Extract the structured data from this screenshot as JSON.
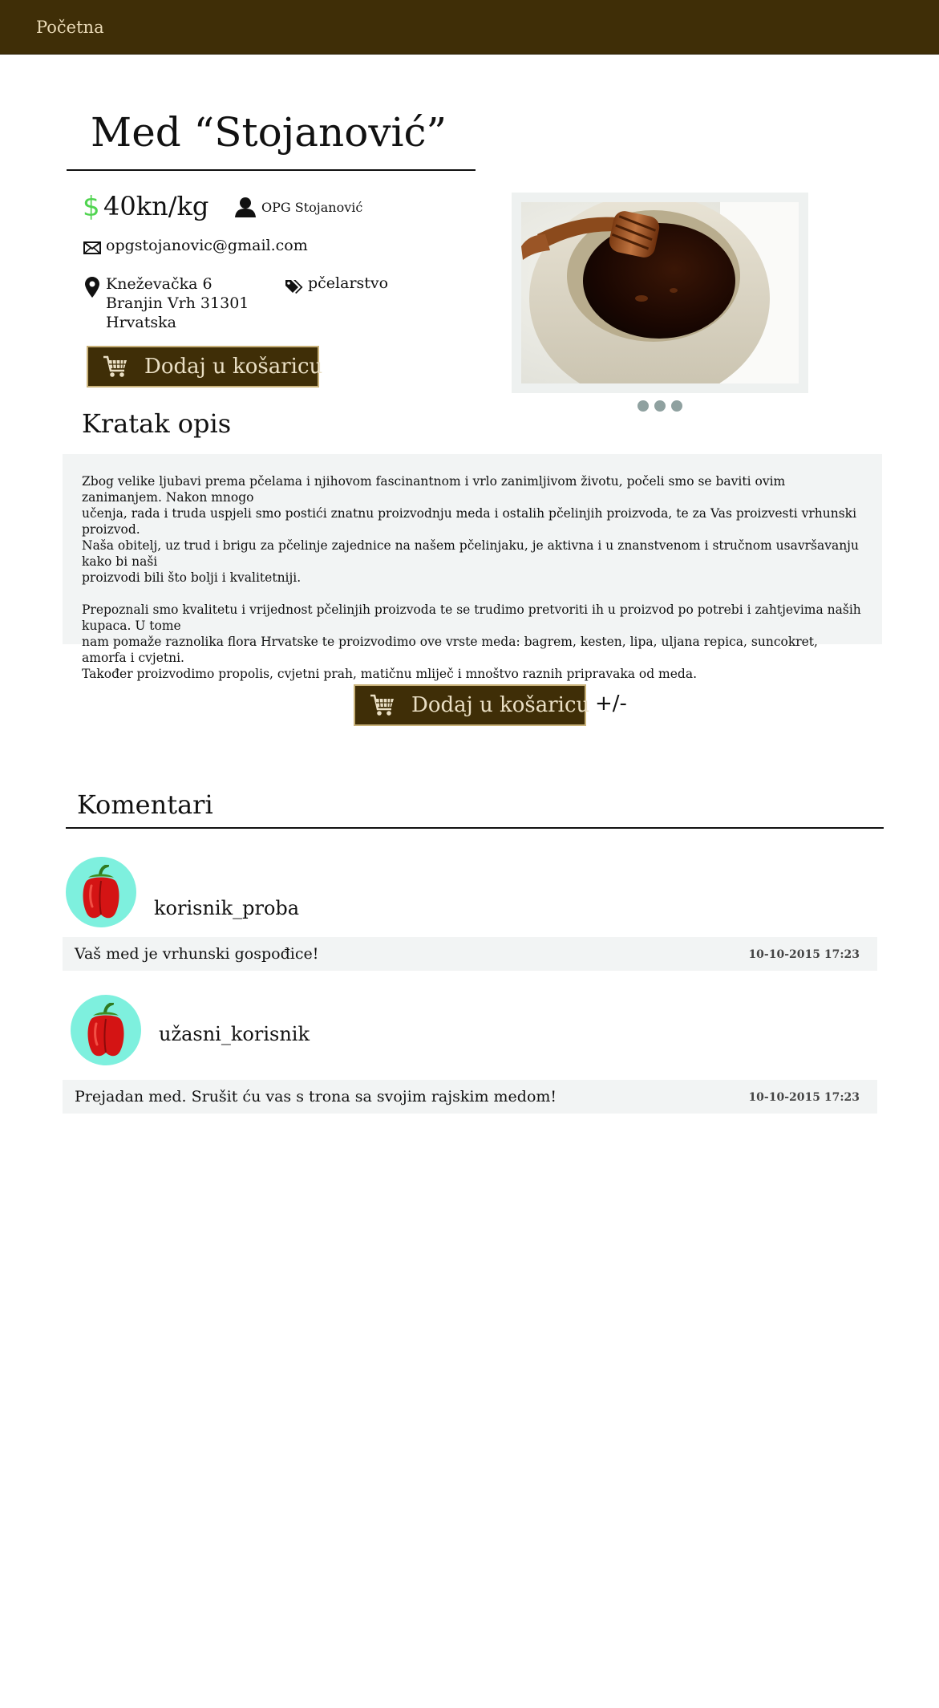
{
  "nav": {
    "home": "Početna"
  },
  "product": {
    "title": "Med “Stojanović”",
    "currency_symbol": "$",
    "price": "40kn/kg",
    "seller": "OPG Stojanović",
    "email": "opgstojanovic@gmail.com",
    "address": [
      "Kneževačka 6",
      "Branjin Vrh 31301",
      "Hrvatska"
    ],
    "category": "pčelarstvo",
    "add_to_cart_label": "Dodaj u košaricu",
    "quantity_toggle": "+/-"
  },
  "gallery": {
    "dot_count": 3,
    "active_dot": 0
  },
  "description": {
    "heading": "Kratak opis",
    "paragraph1_lines": [
      "Zbog velike ljubavi prema pčelama i njihovom fascinantnom i vrlo zanimljivom životu, počeli smo se baviti ovim zanimanjem.  Nakon mnogo",
      "učenja, rada i truda uspjeli smo postići znatnu proizvodnju meda i ostalih pčelinjih proizvoda, te za Vas proizvesti vrhunski proizvod.",
      "Naša obitelj, uz trud i brigu za pčelinje zajednice na našem pčelinjaku, je aktivna i u znanstvenom i stručnom usavršavanju kako bi naši",
      "proizvodi bili što bolji i kvalitetniji."
    ],
    "paragraph2_lines": [
      "Prepoznali smo kvalitetu i vrijednost pčelinjih proizvoda te se trudimo pretvoriti ih u proizvod po potrebi i zahtjevima naših kupaca. U tome",
      "nam pomaže raznolika flora Hrvatske te proizvodimo ove vrste meda: bagrem, kesten, lipa, uljana repica, suncokret, amorfa i cvjetni.",
      "Također proizvodimo propolis, cvjetni prah, matičnu mliječ i mnoštvo raznih pripravaka od meda."
    ]
  },
  "comments": {
    "heading": "Komentari",
    "items": [
      {
        "username": "korisnik_proba",
        "text": "Vaš med je vrhunski gospođice!",
        "date": "10-10-2015  17:23",
        "avatar_icon": "pepper-icon"
      },
      {
        "username": "užasni_korisnik",
        "text": "Prejadan med. Srušit ću vas s trona sa svojim rajskim medom!",
        "date": "10-10-2015  17:23",
        "avatar_icon": "pepper-icon"
      }
    ]
  },
  "colors": {
    "topbar": "#3f2e07",
    "button": "#3f2e07",
    "price_symbol": "#4fd44f",
    "avatar_bg": "#7ef0de",
    "panel_bg": "#f2f4f4"
  }
}
